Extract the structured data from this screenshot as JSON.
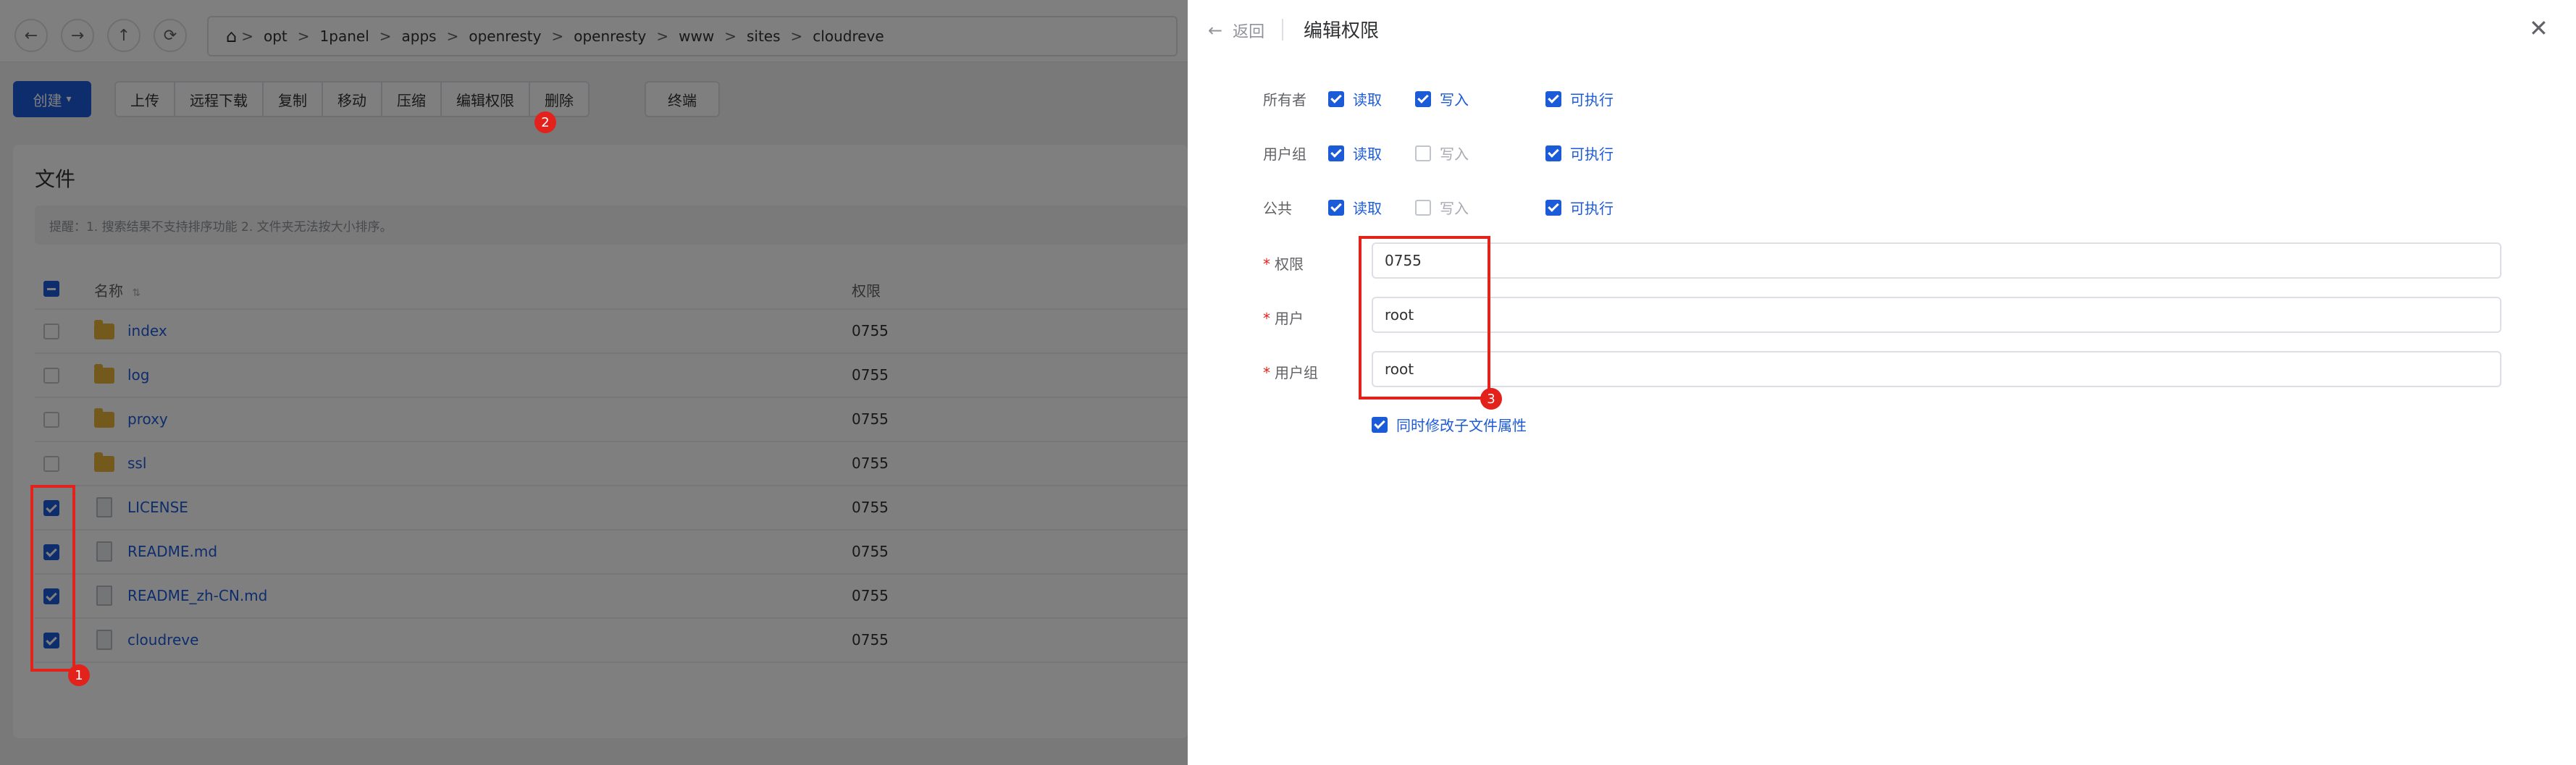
{
  "nav": {
    "back_icon": "arrow-left-icon",
    "forward_icon": "arrow-right-icon",
    "up_icon": "arrow-up-icon",
    "refresh_icon": "refresh-icon",
    "home_icon": "home-icon",
    "path": [
      "opt",
      "1panel",
      "apps",
      "openresty",
      "openresty",
      "www",
      "sites",
      "cloudreve"
    ],
    "separator": ">"
  },
  "toolbar": {
    "create_label": "创建",
    "buttons": [
      "上传",
      "远程下载",
      "复制",
      "移动",
      "压缩",
      "编辑权限",
      "删除"
    ],
    "terminal_label": "终端"
  },
  "card": {
    "title": "文件",
    "tip": "提醒：1. 搜索结果不支持排序功能 2. 文件夹无法按大小排序。",
    "col_name": "名称",
    "col_perm": "权限",
    "rows": [
      {
        "name": "index",
        "type": "folder",
        "perm": "0755",
        "checked": false
      },
      {
        "name": "log",
        "type": "folder",
        "perm": "0755",
        "checked": false
      },
      {
        "name": "proxy",
        "type": "folder",
        "perm": "0755",
        "checked": false
      },
      {
        "name": "ssl",
        "type": "folder",
        "perm": "0755",
        "checked": false
      },
      {
        "name": "LICENSE",
        "type": "file",
        "perm": "0755",
        "checked": true
      },
      {
        "name": "README.md",
        "type": "file",
        "perm": "0755",
        "checked": true
      },
      {
        "name": "README_zh-CN.md",
        "type": "file",
        "perm": "0755",
        "checked": true
      },
      {
        "name": "cloudreve",
        "type": "file",
        "perm": "0755",
        "checked": true
      }
    ]
  },
  "annotations": [
    "1",
    "2",
    "3"
  ],
  "drawer": {
    "back_label": "返回",
    "title": "编辑权限",
    "close_icon": "close-icon",
    "perm_rows": [
      {
        "label": "所有者",
        "read": true,
        "write": true,
        "exec": true
      },
      {
        "label": "用户组",
        "read": true,
        "write": false,
        "exec": true
      },
      {
        "label": "公共",
        "read": true,
        "write": false,
        "exec": true
      }
    ],
    "opt_read": "读取",
    "opt_write": "写入",
    "opt_exec": "可执行",
    "fields": {
      "perm_label": "权限",
      "perm_value": "0755",
      "user_label": "用户",
      "user_value": "root",
      "group_label": "用户组",
      "group_value": "root",
      "required_mark": "*"
    },
    "sub_label": "同时修改子文件属性"
  },
  "colors": {
    "primary": "#1c5bd8",
    "annotation": "#e3221b",
    "folder": "#e8b23a"
  }
}
